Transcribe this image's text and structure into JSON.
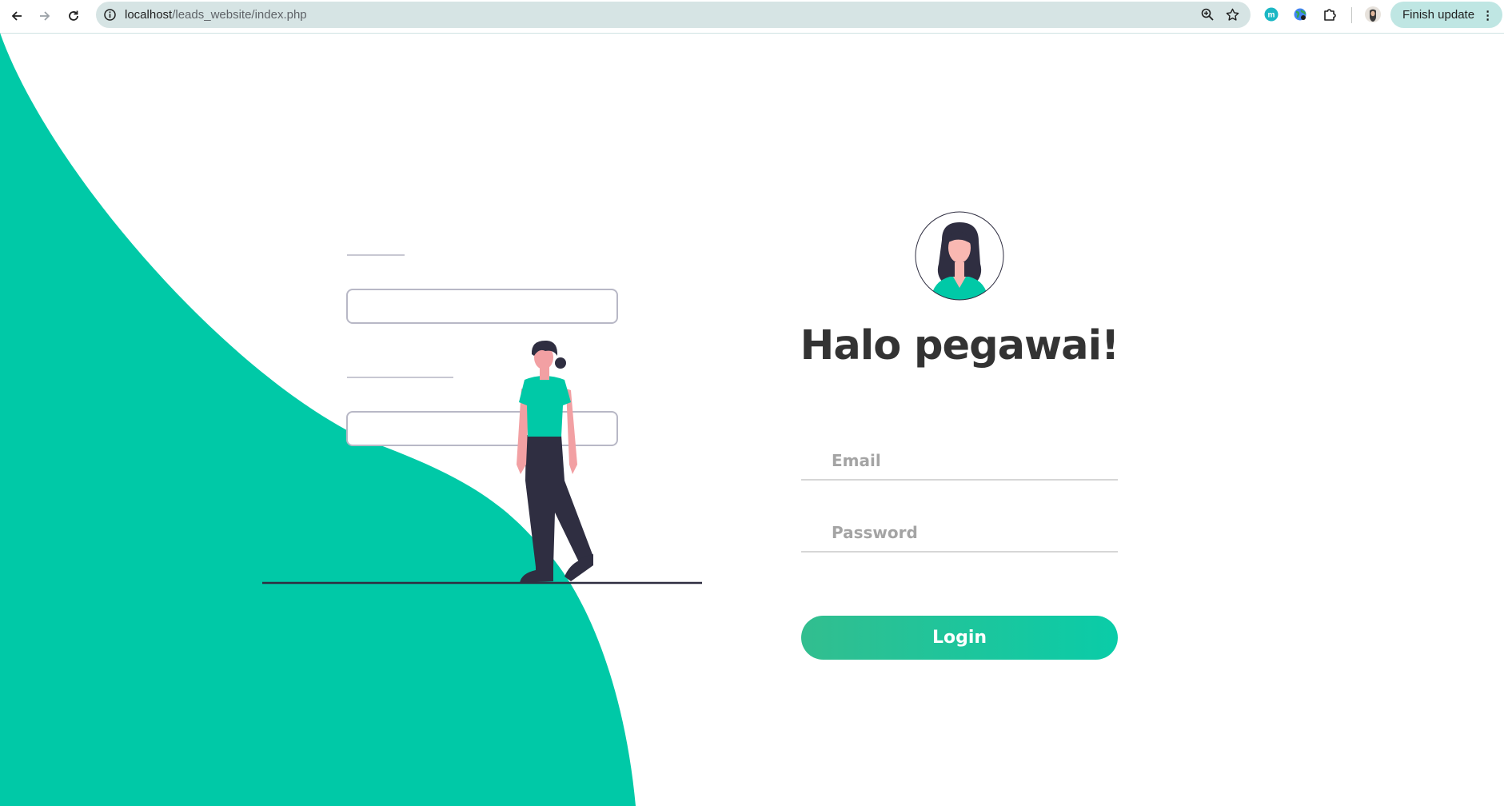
{
  "browser": {
    "url_host": "localhost",
    "url_path": "/leads_website/index.php",
    "finish_update_label": "Finish update",
    "menu_glyph": "⋮",
    "extension_badge": "m",
    "icons": [
      "back-icon",
      "forward-icon",
      "reload-icon",
      "info-icon",
      "zoom-icon",
      "star-icon",
      "extension-m-icon",
      "earth-icon",
      "puzzle-icon",
      "profile-avatar"
    ]
  },
  "login": {
    "greeting": "Halo pegawai!",
    "email_placeholder": "Email",
    "password_placeholder": "Password",
    "login_label": "Login"
  },
  "colors": {
    "accent": "#00c9a7",
    "button_start": "#32be8f",
    "button_end": "#0acca8",
    "heading": "#333333"
  }
}
